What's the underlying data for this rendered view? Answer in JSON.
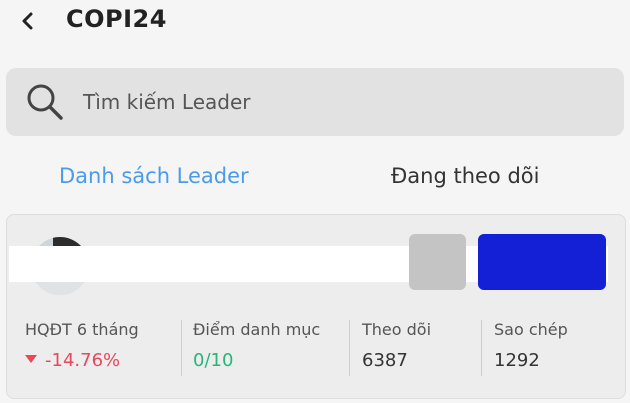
{
  "header": {
    "title": "COPI24",
    "back_icon": "chevron-left-icon"
  },
  "search": {
    "placeholder": "Tìm kiếm Leader",
    "icon": "search-icon"
  },
  "tabs": [
    {
      "label": "Danh sách Leader",
      "active": true
    },
    {
      "label": "Đang theo dõi",
      "active": false
    }
  ],
  "colors": {
    "active_tab": "#4a9bea",
    "negative": "#e8485a",
    "positive": "#27b57a",
    "primary_button": "#1420d6"
  },
  "leader_card": {
    "stats": [
      {
        "label": "HQĐT 6 tháng",
        "value": "-14.76%",
        "trend": "down"
      },
      {
        "label": "Điểm danh mục",
        "value": "0/10"
      },
      {
        "label": "Theo dõi",
        "value": "6387"
      },
      {
        "label": "Sao chép",
        "value": "1292"
      }
    ]
  }
}
